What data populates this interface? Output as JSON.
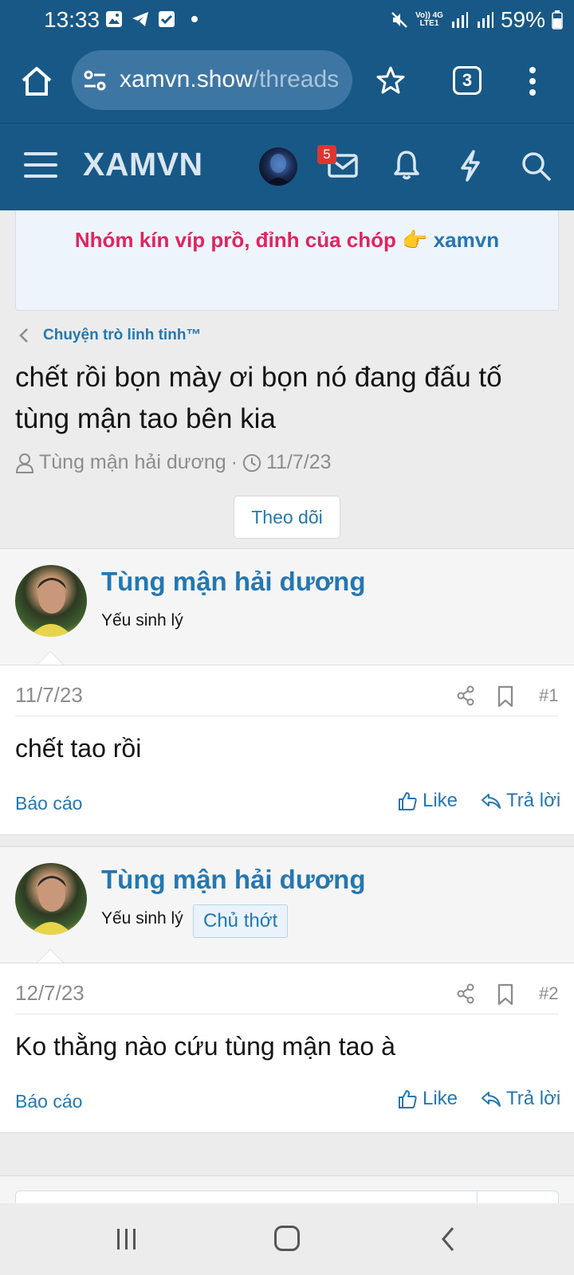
{
  "status_bar": {
    "time": "13:33",
    "network_line1": "Vo)) 4G",
    "network_line2": "LTE1",
    "battery": "59%"
  },
  "browser": {
    "url_host": "xamvn.show",
    "url_path": "/threads",
    "tab_count": "3"
  },
  "site": {
    "logo": "XAMVN",
    "message_badge": "5"
  },
  "notice": {
    "pink_text": "Nhóm kín víp prồ, đỉnh của chóp 👉",
    "link_text": "xamvn"
  },
  "breadcrumb": "Chuyện trò linh tinh™",
  "thread": {
    "title": "chết rồi bọn mày ơi bọn nó đang đấu tố tùng mận tao bên kia",
    "author": "Tùng mận hải dương",
    "separator": "·",
    "date": "11/7/23",
    "follow_label": "Theo dõi"
  },
  "posts": [
    {
      "username": "Tùng mận hải dương",
      "user_title": "Yếu sinh lý",
      "date": "11/7/23",
      "number": "#1",
      "content": "chết tao rồi",
      "report_label": "Báo cáo",
      "like_label": "Like",
      "reply_label": "Trả lời"
    },
    {
      "username": "Tùng mận hải dương",
      "user_title": "Yếu sinh lý",
      "role_badge": "Chủ thớt",
      "date": "12/7/23",
      "number": "#2",
      "content": "Ko thằng nào cứu tùng mận tao à",
      "report_label": "Báo cáo",
      "like_label": "Like",
      "reply_label": "Trả lời"
    }
  ],
  "colors": {
    "header_blue": "#185886",
    "link_blue": "#2577b1",
    "notice_pink": "#e0245e",
    "badge_red": "#e0352f"
  }
}
